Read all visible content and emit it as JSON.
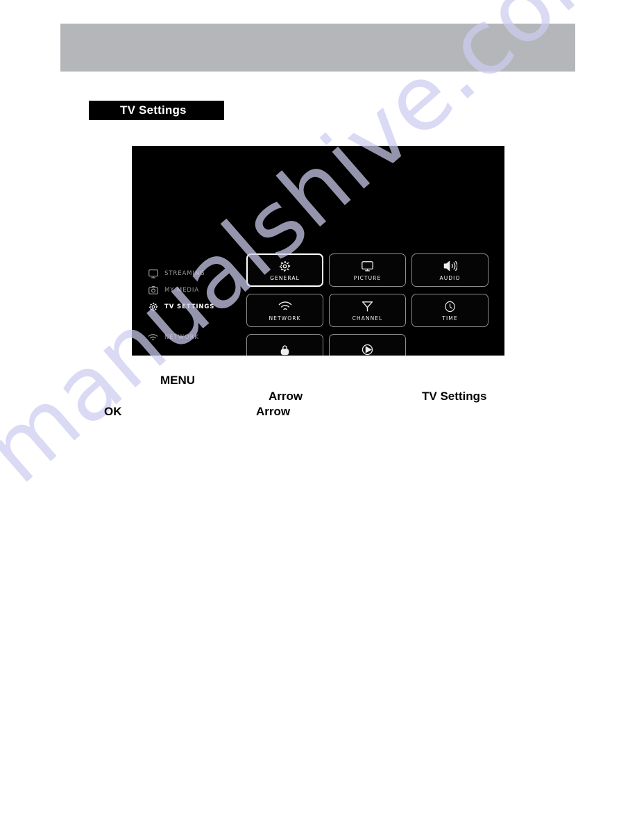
{
  "page": {
    "watermark": "manualshive.com",
    "header_bar_color": "#b4b6b9",
    "background_color": "#ffffff"
  },
  "section": {
    "chip_title": "TV Settings",
    "chip_background": "#000000",
    "chip_text_color": "#ffffff"
  },
  "tv_screen": {
    "background": "#000000",
    "sidebar": {
      "items": [
        {
          "label": "STREAMING",
          "icon": "monitor-icon",
          "active": false
        },
        {
          "label": "MY MEDIA",
          "icon": "camera-icon",
          "active": false
        },
        {
          "label": "TV SETTINGS",
          "icon": "gear-icon",
          "active": true
        },
        {
          "label": "NETWORK",
          "icon": "wifi-icon",
          "active": false
        }
      ]
    },
    "tiles": [
      {
        "label": "GENERAL",
        "icon": "gear-icon",
        "selected": true
      },
      {
        "label": "PICTURE",
        "icon": "monitor-icon",
        "selected": false
      },
      {
        "label": "AUDIO",
        "icon": "speaker-icon",
        "selected": false
      },
      {
        "label": "NETWORK",
        "icon": "wifi-icon",
        "selected": false
      },
      {
        "label": "CHANNEL",
        "icon": "antenna-icon",
        "selected": false
      },
      {
        "label": "TIME",
        "icon": "clock-icon",
        "selected": false
      },
      {
        "label": "",
        "icon": "lock-icon",
        "selected": false
      },
      {
        "label": "",
        "icon": "play-circle-icon",
        "selected": false
      }
    ]
  },
  "body_keywords": {
    "menu": "MENU",
    "arrow_1": "Arrow",
    "arrow_2": "Arrow",
    "tv_settings": "TV Settings",
    "ok": "OK"
  }
}
